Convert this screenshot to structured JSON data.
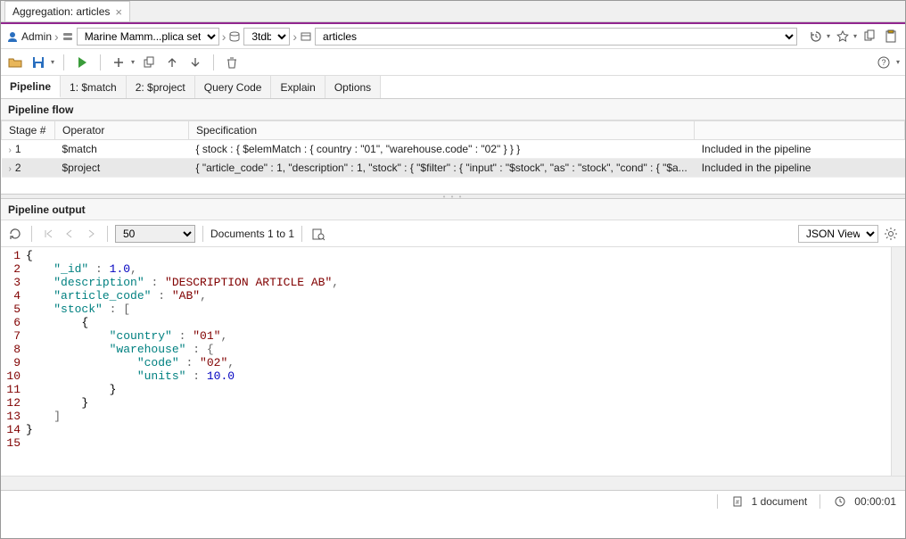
{
  "tab": {
    "title": "Aggregation: articles"
  },
  "breadcrumb": {
    "user": "Admin",
    "connection": "Marine Mamm...plica set]",
    "database": "3tdb",
    "collection": "articles"
  },
  "subtabs": {
    "pipeline": "Pipeline",
    "stage1": "1: $match",
    "stage2": "2: $project",
    "querycode": "Query Code",
    "explain": "Explain",
    "options": "Options"
  },
  "flow": {
    "header": "Pipeline flow",
    "columns": {
      "stage": "Stage #",
      "operator": "Operator",
      "spec": "Specification",
      "included": ""
    },
    "rows": [
      {
        "stage": "1",
        "operator": "$match",
        "spec": "{ stock : { $elemMatch : { country : \"01\", \"warehouse.code\" : \"02\" } } }",
        "included": "Included in the pipeline"
      },
      {
        "stage": "2",
        "operator": "$project",
        "spec": "{ \"article_code\" : 1, \"description\" : 1, \"stock\" : { \"$filter\" : { \"input\" : \"$stock\", \"as\" : \"stock\", \"cond\" : { \"$a...",
        "included": "Included in the pipeline"
      }
    ]
  },
  "output": {
    "header": "Pipeline output",
    "page_size": "50",
    "docs_label": "Documents 1 to 1",
    "view_mode": "JSON View"
  },
  "code": {
    "lines": [
      [
        {
          "t": "brace",
          "v": "{"
        }
      ],
      [
        {
          "t": "sp",
          "v": "    "
        },
        {
          "t": "key",
          "v": "\"_id\""
        },
        {
          "t": "punct",
          "v": " : "
        },
        {
          "t": "num",
          "v": "1.0"
        },
        {
          "t": "punct",
          "v": ","
        }
      ],
      [
        {
          "t": "sp",
          "v": "    "
        },
        {
          "t": "key",
          "v": "\"description\""
        },
        {
          "t": "punct",
          "v": " : "
        },
        {
          "t": "str",
          "v": "\"DESCRIPTION ARTICLE AB\""
        },
        {
          "t": "punct",
          "v": ","
        }
      ],
      [
        {
          "t": "sp",
          "v": "    "
        },
        {
          "t": "key",
          "v": "\"article_code\""
        },
        {
          "t": "punct",
          "v": " : "
        },
        {
          "t": "str",
          "v": "\"AB\""
        },
        {
          "t": "punct",
          "v": ","
        }
      ],
      [
        {
          "t": "sp",
          "v": "    "
        },
        {
          "t": "key",
          "v": "\"stock\""
        },
        {
          "t": "punct",
          "v": " : ["
        }
      ],
      [
        {
          "t": "sp",
          "v": "        "
        },
        {
          "t": "brace",
          "v": "{"
        }
      ],
      [
        {
          "t": "sp",
          "v": "            "
        },
        {
          "t": "key",
          "v": "\"country\""
        },
        {
          "t": "punct",
          "v": " : "
        },
        {
          "t": "str",
          "v": "\"01\""
        },
        {
          "t": "punct",
          "v": ","
        }
      ],
      [
        {
          "t": "sp",
          "v": "            "
        },
        {
          "t": "key",
          "v": "\"warehouse\""
        },
        {
          "t": "punct",
          "v": " : {"
        }
      ],
      [
        {
          "t": "sp",
          "v": "                "
        },
        {
          "t": "key",
          "v": "\"code\""
        },
        {
          "t": "punct",
          "v": " : "
        },
        {
          "t": "str",
          "v": "\"02\""
        },
        {
          "t": "punct",
          "v": ","
        }
      ],
      [
        {
          "t": "sp",
          "v": "                "
        },
        {
          "t": "key",
          "v": "\"units\""
        },
        {
          "t": "punct",
          "v": " : "
        },
        {
          "t": "num",
          "v": "10.0"
        }
      ],
      [
        {
          "t": "sp",
          "v": "            "
        },
        {
          "t": "brace",
          "v": "}"
        }
      ],
      [
        {
          "t": "sp",
          "v": "        "
        },
        {
          "t": "brace",
          "v": "}"
        }
      ],
      [
        {
          "t": "sp",
          "v": "    "
        },
        {
          "t": "punct",
          "v": "]"
        }
      ],
      [
        {
          "t": "brace",
          "v": "}"
        }
      ],
      []
    ]
  },
  "status": {
    "docs": "1 document",
    "time": "00:00:01"
  }
}
